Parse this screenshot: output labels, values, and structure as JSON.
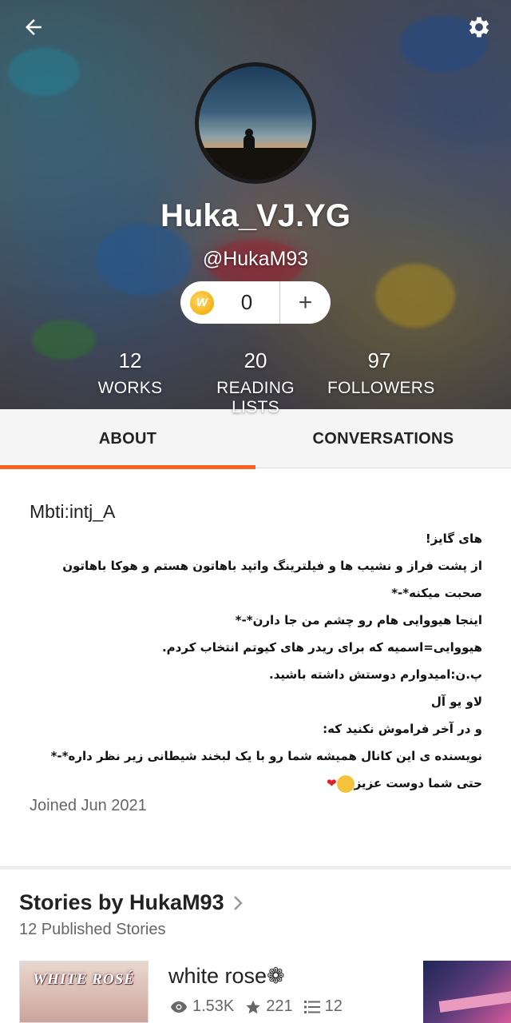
{
  "header": {
    "display_name": "Huka_VJ.YG",
    "username": "@HukaM93",
    "coins": "0",
    "coin_symbol": "W",
    "add_label": "+",
    "stats": [
      {
        "value": "12",
        "label": "WORKS"
      },
      {
        "value": "20",
        "label": "READING LISTS"
      },
      {
        "value": "97",
        "label": "FOLLOWERS"
      }
    ]
  },
  "tabs": [
    {
      "label": "ABOUT",
      "active": true
    },
    {
      "label": "CONVERSATIONS",
      "active": false
    }
  ],
  "about": {
    "mbti": "Mbti:intj_A",
    "bio_lines": [
      "های گایز!",
      "از پشت فراز و نشیب ها و فیلترینگ واتپد باهاتون هستم و هوکا باهاتون",
      "صحبت میکنه*-*",
      "اینجا هیووایی هام رو چشم من جا دارن*-*",
      "هیووایی=اسمیه که برای ریدر های کیوتم انتخاب کردم.",
      "پ.ن:امیدوارم دوستش داشته باشید.",
      "لاو یو آل",
      "و در آخر فراموش نکنید که:",
      "نویسنده ی این کانال همیشه شما رو با یک لبخند شیطانی زیر نظر داره*-*",
      "حتی شما دوست عزیز"
    ],
    "joined": "Joined Jun 2021"
  },
  "stories": {
    "title": "Stories by HukaM93",
    "count_label": "12 Published Stories",
    "items": [
      {
        "cover_text": "WHITE ROSÉ",
        "title": "white rose❁",
        "reads": "1.53K",
        "votes": "221",
        "parts": "12"
      }
    ]
  },
  "colors": {
    "accent": "#ff6122",
    "header_text": "#ffffff",
    "coin": "#f5b316"
  },
  "icons": [
    "back-arrow-icon",
    "gear-icon",
    "coin-icon",
    "plus-icon",
    "chevron-right-icon",
    "eye-icon",
    "star-icon",
    "list-icon"
  ]
}
